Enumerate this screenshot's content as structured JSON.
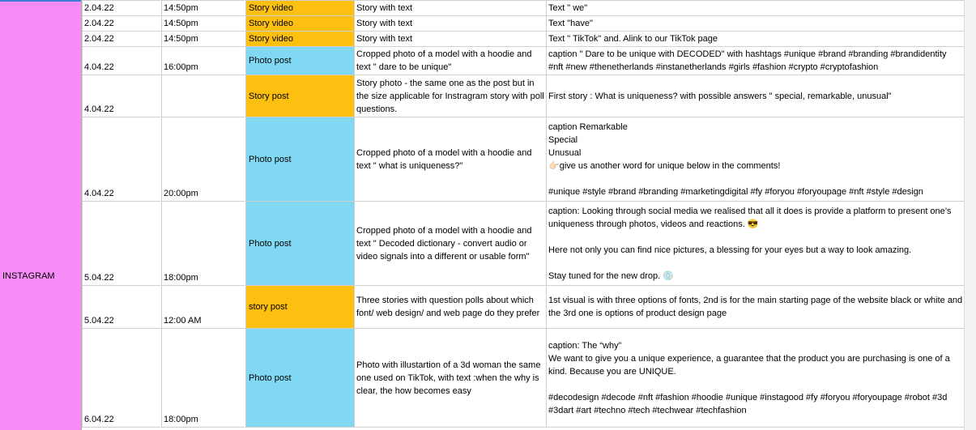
{
  "platform": "INSTAGRAM",
  "colors": {
    "platform_bg": "#f78cf7",
    "story_bg": "#fdbf10",
    "photo_bg": "#80d8f2"
  },
  "rows": [
    {
      "date": "2.04.22",
      "time": "14:50pm",
      "type": "Story  video",
      "type_color": "orange",
      "desc": "Story with text",
      "content": "Text \" we\"",
      "h": 17
    },
    {
      "date": "2.04.22",
      "time": "14:50pm",
      "type": "Story  video",
      "type_color": "orange",
      "desc": "Story with text",
      "content": "Text \"have\"",
      "h": 17
    },
    {
      "date": "2.04.22",
      "time": "14:50pm",
      "type": "Story  video",
      "type_color": "orange",
      "desc": "Story with text",
      "content": "Text \" TikTok\" and. Alink to our TikTok page",
      "h": 17
    },
    {
      "date": "4.04.22",
      "time": "16:00pm",
      "type": "Photo post",
      "type_color": "blue",
      "desc": "Cropped photo of a model with a hoodie and text \" dare to be unique\"",
      "content": "caption \" Dare to be unique with DECODED\"  with hashtags #unique #brand #branding #brandidentity #nft #new #thenetherlands #instanetherlands #girls #fashion #crypto #cryptofashion",
      "h": 34
    },
    {
      "date": "4.04.22",
      "time": "",
      "type": "Story post",
      "type_color": "orange",
      "desc": "Story photo - the same one as the post but in the size applicable for Instragram story with poll questions.",
      "content": "First story : What is uniqueness? with possible answers \" special, remarkable, unusual\"",
      "h": 52
    },
    {
      "date": "4.04.22",
      "time": "20:00pm",
      "type": "Photo post",
      "type_color": "blue",
      "desc": "Cropped photo of a model with a hoodie and text \" what is uniqueness?\"",
      "content": "caption Remarkable\nSpecial\nUnusual\n👉🏻give us another word for unique below in the comments!\n\n#unique #style #brand #branding #marketingdigital #fy #foryou #foryoupage #nft #style #design",
      "h": 104
    },
    {
      "date": "5.04.22",
      "time": "18:00pm",
      "type": "Photo post",
      "type_color": "blue",
      "desc": "Cropped photo of a model with a hoodie and text \" Decoded dictionary - convert audio or video signals into a different or usable form\"",
      "content": "caption: Looking through social media we realised that all it does is provide a platform to present one’s uniqueness through photos, videos and reactions. 😎\n\nHere not only you can find nice pictures, a blessing for your eyes but a way to look amazing.\n\nStay tuned for the new drop. 💿",
      "h": 104
    },
    {
      "date": "5.04.22",
      "time": "12:00 AM",
      "type": "story post",
      "type_color": "orange",
      "desc": "Three stories with question polls about which font/ web design/ and web page do they prefer",
      "content": "1st visual is with three options of fonts, 2nd is for the main starting page of the website black or white and the 3rd one is options of product design page",
      "h": 53
    },
    {
      "date": "6.04.22",
      "time": "18:00pm",
      "type": "Photo post",
      "type_color": "blue",
      "desc": "Photo with illustartion of a 3d woman the same one used on TikTok, with text :when the why is clear, the how becomes easy",
      "content": "caption: The “why”\nWe want to give you a unique experience, a guarantee that the product you are purchasing is one of a kind. Because you are UNIQUE.\n\n#decodesign #decode #nft #fashion #hoodie #unique #instagood #fy #foryou #foryoupage #robot #3d #3dart #art #techno #tech #techwear #techfashion",
      "h": 122
    }
  ]
}
